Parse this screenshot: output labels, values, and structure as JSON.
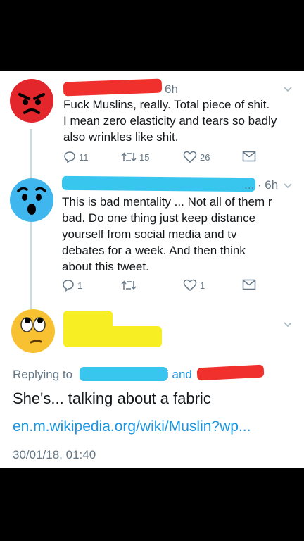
{
  "tweet1": {
    "time": "6h",
    "lines": [
      "Fuck Muslins, really. Total piece of shit.",
      "I mean zero elasticity and tears so badly",
      "also wrinkles like shit."
    ],
    "replies": "11",
    "retweets": "15",
    "likes": "26"
  },
  "tweet2": {
    "time": "... · 6h",
    "lines": [
      "This is bad mentality ... Not all of them r",
      "bad. Do one thing just keep distance",
      "yourself from social media and tv",
      "debates for a week. And then think",
      "about this tweet."
    ],
    "replies": "1",
    "retweets": "",
    "likes": "1"
  },
  "tweet3": {
    "replying_prefix": "Replying to",
    "replying_and": "i and",
    "text": "She's... talking about a fabric",
    "link": "en.m.wikipedia.org/wiki/Muslin?wp...",
    "date": "30/01/18, 01:40"
  },
  "colors": {
    "redact_red": "#f0302c",
    "redact_blue": "#39c6ee",
    "redact_yellow": "#f7ef24",
    "avatar_angry": "#e3262b",
    "avatar_surprised": "#3fb6ee",
    "avatar_eyeroll": "#f8c132",
    "link": "#1b95e0"
  },
  "icons": [
    "reply-icon",
    "retweet-icon",
    "like-icon",
    "message-icon",
    "chevron-down-icon",
    "angry-face-icon",
    "surprised-face-icon",
    "eye-roll-face-icon"
  ]
}
